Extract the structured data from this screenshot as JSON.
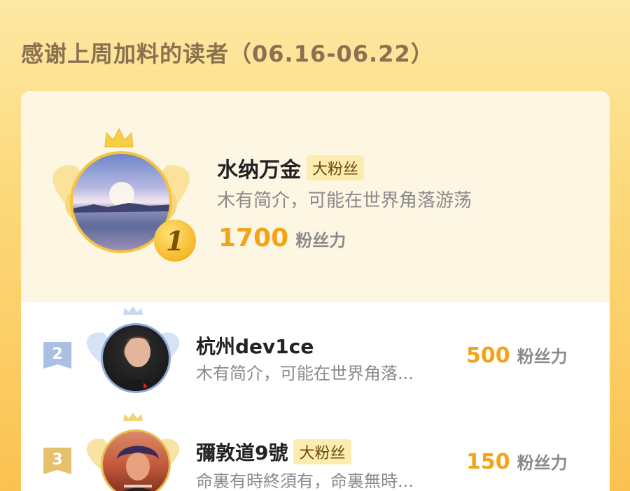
{
  "header": {
    "title": "感谢上周加料的读者（06.16-06.22）"
  },
  "colors": {
    "accent": "#f2a316",
    "tag_bg": "#fdecb0",
    "rank2": "#9fb9dd",
    "rank3": "#e8c06a"
  },
  "readers": [
    {
      "rank": "1",
      "name": "水纳万金",
      "tag": "大粉丝",
      "bio": "木有简介，可能在世界角落游荡",
      "score": "1700",
      "score_unit": "粉丝力"
    },
    {
      "rank": "2",
      "name": "杭州dev1ce",
      "tag": "",
      "bio": "木有简介，可能在世界角落...",
      "score": "500",
      "score_unit": "粉丝力"
    },
    {
      "rank": "3",
      "name": "彌敦道9號",
      "tag": "大粉丝",
      "bio": "命裏有時終須有，命裏無時...",
      "score": "150",
      "score_unit": "粉丝力"
    }
  ]
}
